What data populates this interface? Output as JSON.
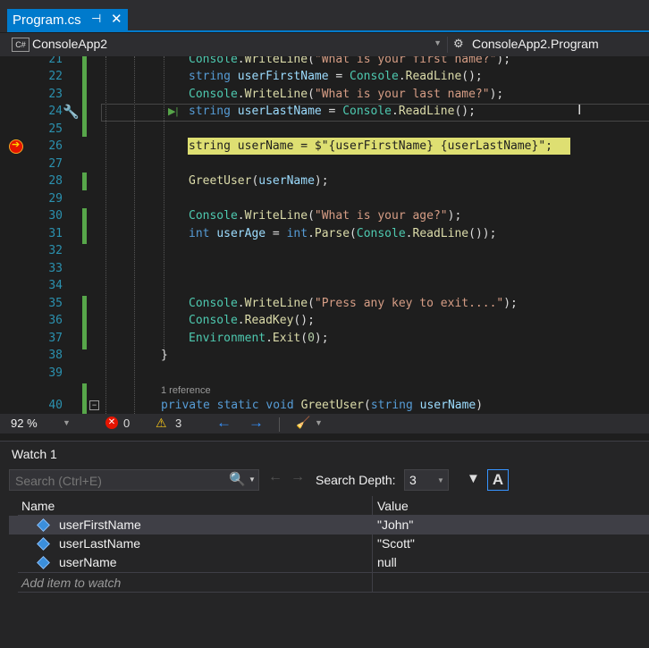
{
  "tab": {
    "title": "Program.cs",
    "pin_glyph": "⊣",
    "close_glyph": "✕"
  },
  "navbar": {
    "project_icon": "C#",
    "project": "ConsoleApp2",
    "class": "ConsoleApp2.Program"
  },
  "code_lines": [
    {
      "n": "21"
    },
    {
      "n": "22"
    },
    {
      "n": "23"
    },
    {
      "n": "24"
    },
    {
      "n": "25"
    },
    {
      "n": "26"
    },
    {
      "n": "27"
    },
    {
      "n": "28"
    },
    {
      "n": "29"
    },
    {
      "n": "30"
    },
    {
      "n": "31"
    },
    {
      "n": "32"
    },
    {
      "n": "33"
    },
    {
      "n": "34"
    },
    {
      "n": "35"
    },
    {
      "n": "36"
    },
    {
      "n": "37"
    },
    {
      "n": "38"
    },
    {
      "n": "39"
    },
    {
      "n": "40"
    }
  ],
  "code": {
    "l21": {
      "obj": "Console",
      "method": "WriteLine",
      "open": "(",
      "str": "\"What is your first name?\"",
      "close": ");"
    },
    "l22": {
      "kw": "string",
      "var": "userFirstName",
      "eq": " = ",
      "obj": "Console",
      "method": "ReadLine",
      "rest": "();"
    },
    "l23": {
      "obj": "Console",
      "method": "WriteLine",
      "open": "(",
      "str": "\"What is your last name?\"",
      "close": ");"
    },
    "l24": {
      "kw": "string",
      "var": "userLastName",
      "eq": " = ",
      "obj": "Console",
      "method": "ReadLine",
      "rest": "();"
    },
    "l26": {
      "text": "string userName = $\"{userFirstName} {userLastName}\";"
    },
    "l28": {
      "method": "GreetUser",
      "open": "(",
      "arg": "userName",
      "close": ");"
    },
    "l30": {
      "obj": "Console",
      "method": "WriteLine",
      "open": "(",
      "str": "\"What is your age?\"",
      "close": ");"
    },
    "l31": {
      "kw": "int",
      "var": "userAge",
      "eq": " = ",
      "kw2": "int",
      "method": "Parse",
      "open": "(",
      "obj": "Console",
      "method2": "ReadLine",
      "rest": "());"
    },
    "l35": {
      "obj": "Console",
      "method": "WriteLine",
      "open": "(",
      "str": "\"Press any key to exit....\"",
      "close": ");"
    },
    "l36": {
      "obj": "Console",
      "method": "ReadKey",
      "rest": "();"
    },
    "l37": {
      "obj": "Environment",
      "method": "Exit",
      "open": "(",
      "num": "0",
      "close": ");"
    },
    "l38": {
      "text": "}"
    },
    "reference": "1 reference",
    "l40": {
      "kw1": "private",
      "kw2": "static",
      "kw3": "void",
      "method": "GreetUser",
      "open": "(",
      "kw4": "string",
      "param": "userName",
      "close": ")"
    }
  },
  "status": {
    "zoom": "92 %",
    "errors": "0",
    "warnings": "3",
    "error_glyph": "✕",
    "warn_glyph": "⚠"
  },
  "watch": {
    "title": "Watch 1",
    "search_placeholder": "Search (Ctrl+E)",
    "search_depth_label": "Search Depth:",
    "search_depth_value": "3",
    "a_button": "A",
    "columns": {
      "name": "Name",
      "value": "Value"
    },
    "rows": [
      {
        "name": "userFirstName",
        "value": "\"John\""
      },
      {
        "name": "userLastName",
        "value": "\"Scott\""
      },
      {
        "name": "userName",
        "value": "null"
      }
    ],
    "add_item": "Add item to watch"
  },
  "colors": {
    "accent": "#007acc",
    "editor_bg": "#1e1e1e",
    "keyword": "#569cd6",
    "type": "#4ec9b0",
    "string": "#d69d85",
    "identifier": "#9cdcfe",
    "method": "#dcdcaa",
    "line_number": "#2b91af",
    "current_statement_highlight": "#eff07a",
    "breakpoint": "#e51400"
  }
}
